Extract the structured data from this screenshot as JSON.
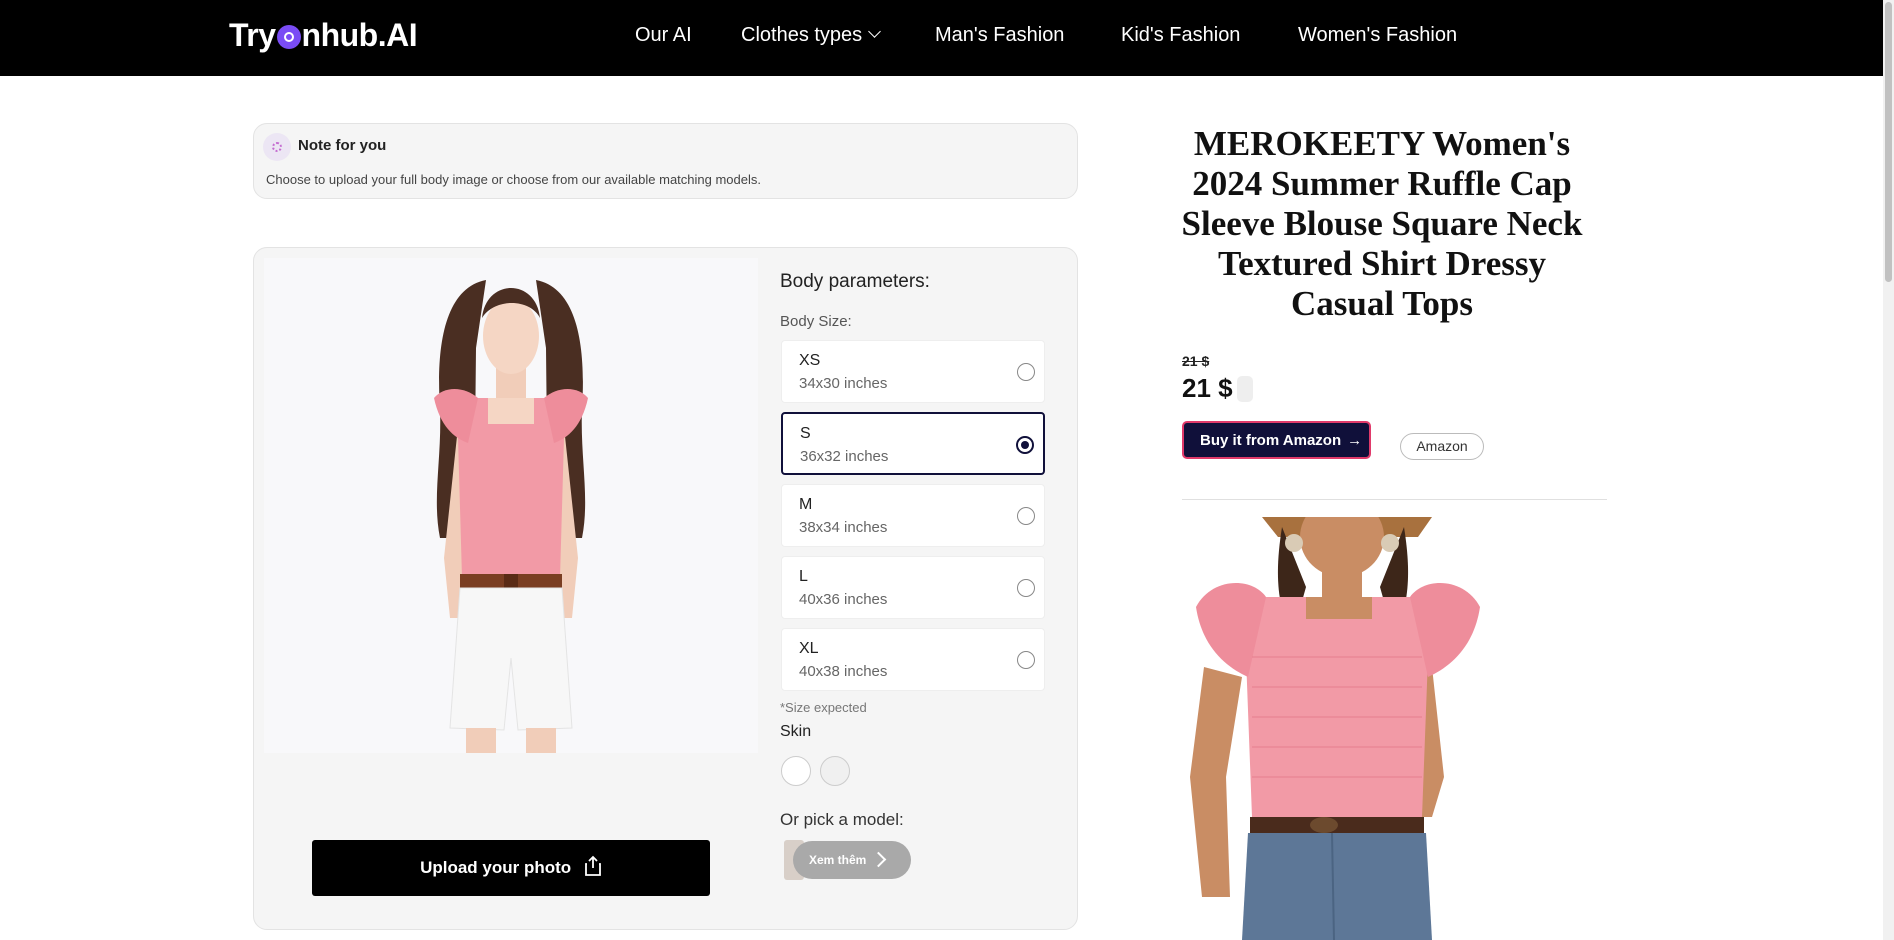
{
  "nav": {
    "logo_text": "TryOnhub.AI",
    "logo_prefix": "Try",
    "logo_suffix": "nhub.AI",
    "items": [
      {
        "label": "Our AI"
      },
      {
        "label": "Clothes types"
      },
      {
        "label": "Man's Fashion"
      },
      {
        "label": "Kid's Fashion"
      },
      {
        "label": "Women's Fashion"
      }
    ]
  },
  "note": {
    "title": "Note for you",
    "text": "Choose to upload your full body image or choose from our available matching models."
  },
  "body_params": {
    "title": "Body parameters:",
    "size_label": "Body Size:",
    "sizes": [
      {
        "name": "XS",
        "dims": "34x30 inches",
        "selected": false
      },
      {
        "name": "S",
        "dims": "36x32 inches",
        "selected": true
      },
      {
        "name": "M",
        "dims": "38x34 inches",
        "selected": false
      },
      {
        "name": "L",
        "dims": "40x36 inches",
        "selected": false
      },
      {
        "name": "XL",
        "dims": "40x38 inches",
        "selected": false
      }
    ],
    "size_note": "*Size expected",
    "skin_label": "Skin",
    "skin_colors": [
      "#ffffff",
      "#f0f0f0"
    ],
    "model_label": "Or pick a model:",
    "more_button": "Xem thêm"
  },
  "upload": {
    "label": "Upload your photo"
  },
  "product": {
    "title": "MEROKEETY Women's 2024 Summer Ruffle Cap Sleeve Blouse Square Neck Textured Shirt Dressy Casual Tops",
    "old_price": "21 $",
    "price": "21 $",
    "buy_label": "Buy it from Amazon",
    "store": "Amazon"
  },
  "colors": {
    "nav_bg": "#000000",
    "accent_dark": "#10103a",
    "buy_border": "#e03a6a",
    "top_pink": "#f29aa6"
  }
}
